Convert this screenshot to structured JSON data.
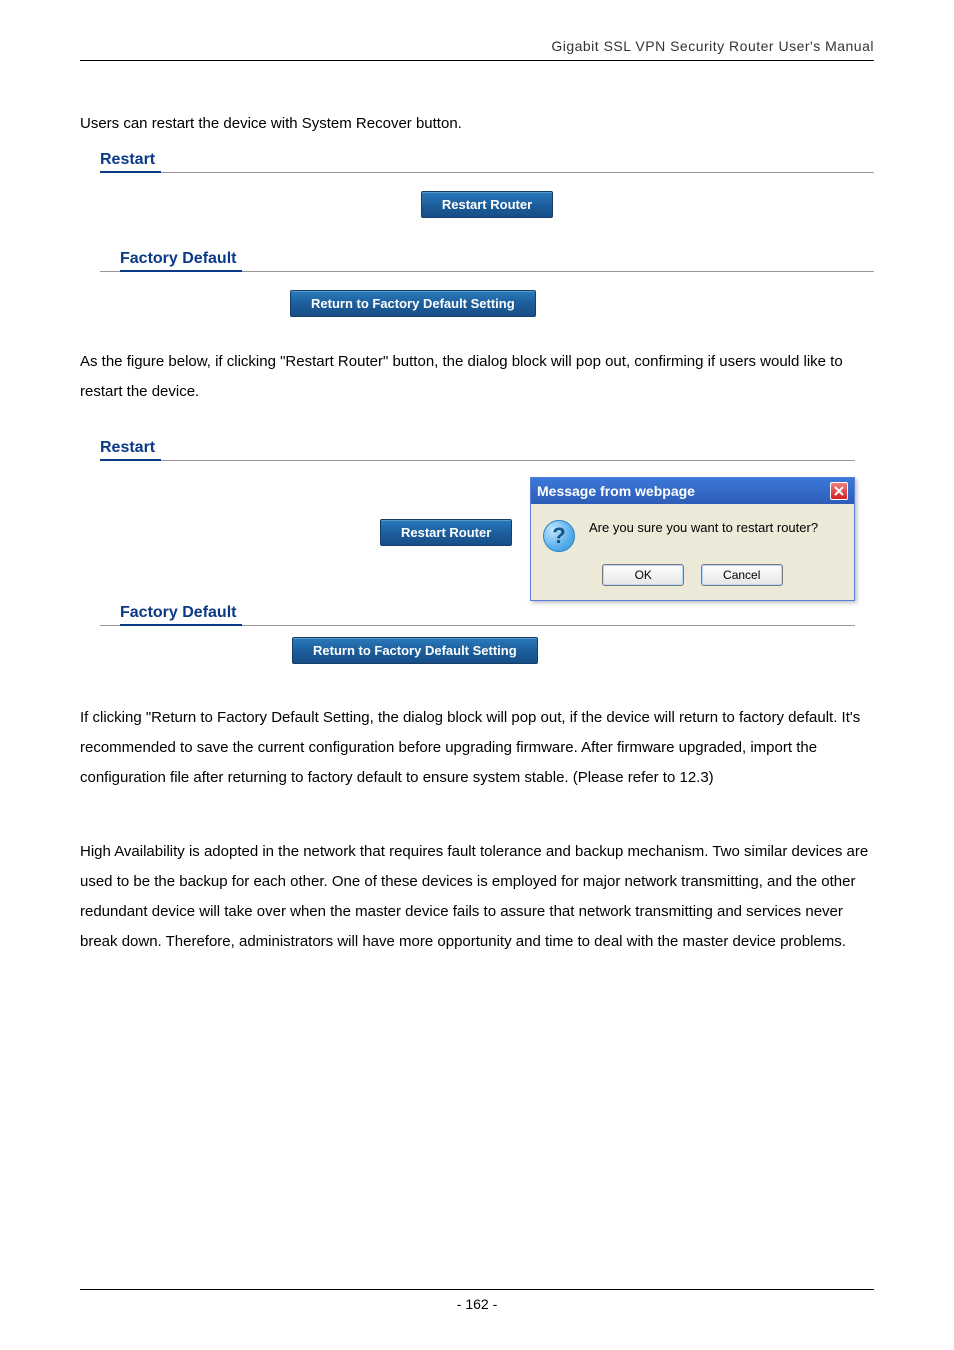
{
  "header": {
    "title": "Gigabit SSL VPN Security Router User's Manual"
  },
  "intro": "Users can restart the device with System Recover button.",
  "figure1": {
    "restart_heading": "Restart",
    "restart_button": "Restart Router",
    "factory_heading": "Factory Default",
    "factory_button": "Return to Factory Default Setting"
  },
  "para2": "As the figure below, if clicking \"Restart Router\" button, the dialog block will pop out, confirming if users would like to restart the device.",
  "figure2": {
    "restart_heading": "Restart",
    "restart_button": "Restart Router",
    "factory_heading": "Factory Default",
    "factory_button": "Return to Factory Default Setting",
    "dialog": {
      "title": "Message from webpage",
      "message": "Are you sure you want to restart router?",
      "ok": "OK",
      "cancel": "Cancel"
    }
  },
  "para3": "If clicking \"Return to Factory Default Setting, the dialog block will pop out, if the device will return to factory default. It's recommended to save the current configuration before upgrading firmware. After firmware upgraded, import the configuration file after returning to factory default to ensure system stable. (Please refer to 12.3)",
  "para4": "High Availability is adopted in the network that requires fault tolerance and backup mechanism. Two similar devices are used to be the backup for each other. One of these devices is employed for major network transmitting, and the other redundant device will take over when the master device fails to assure that network transmitting and services never break down. Therefore, administrators will have more opportunity and time to deal with the master device problems.",
  "footer": {
    "page": "- 162 -"
  }
}
